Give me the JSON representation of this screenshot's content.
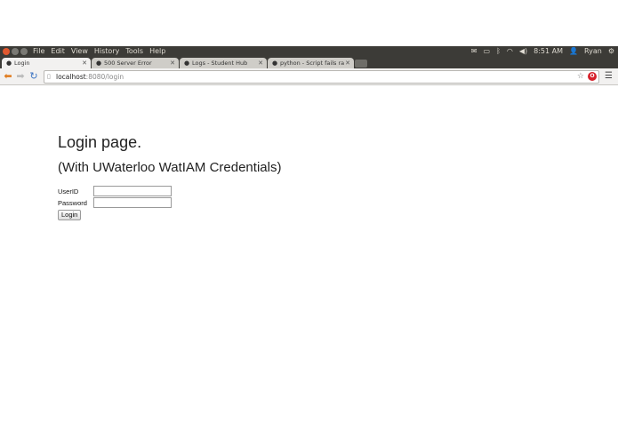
{
  "menubar": {
    "items": [
      "File",
      "Edit",
      "View",
      "History",
      "Tools",
      "Help"
    ],
    "tray": {
      "time": "8:51 AM",
      "user": "Ryan"
    }
  },
  "tabs": [
    {
      "label": "Login",
      "favicon": "globe-icon",
      "active": true
    },
    {
      "label": "500 Server Error",
      "favicon": "globe-icon",
      "active": false
    },
    {
      "label": "Logs - Student Hub",
      "favicon": "globe-icon",
      "active": false
    },
    {
      "label": "python - Script fails rand",
      "favicon": "globe-icon",
      "active": false
    }
  ],
  "toolbar": {
    "url_host": "localhost",
    "url_path": ":8080/login"
  },
  "page": {
    "title": "Login page.",
    "subtitle": "(With UWaterloo WatIAM Credentials)",
    "userid_label": "UserID",
    "userid_value": "",
    "password_label": "Password",
    "password_value": "",
    "login_button": "Login"
  },
  "colors": {
    "chrome_dark": "#3c3b37",
    "toolbar": "#f2f1f0",
    "close_button": "#e0582f",
    "back_arrow": "#e07b1d",
    "reload": "#3b73c3"
  }
}
